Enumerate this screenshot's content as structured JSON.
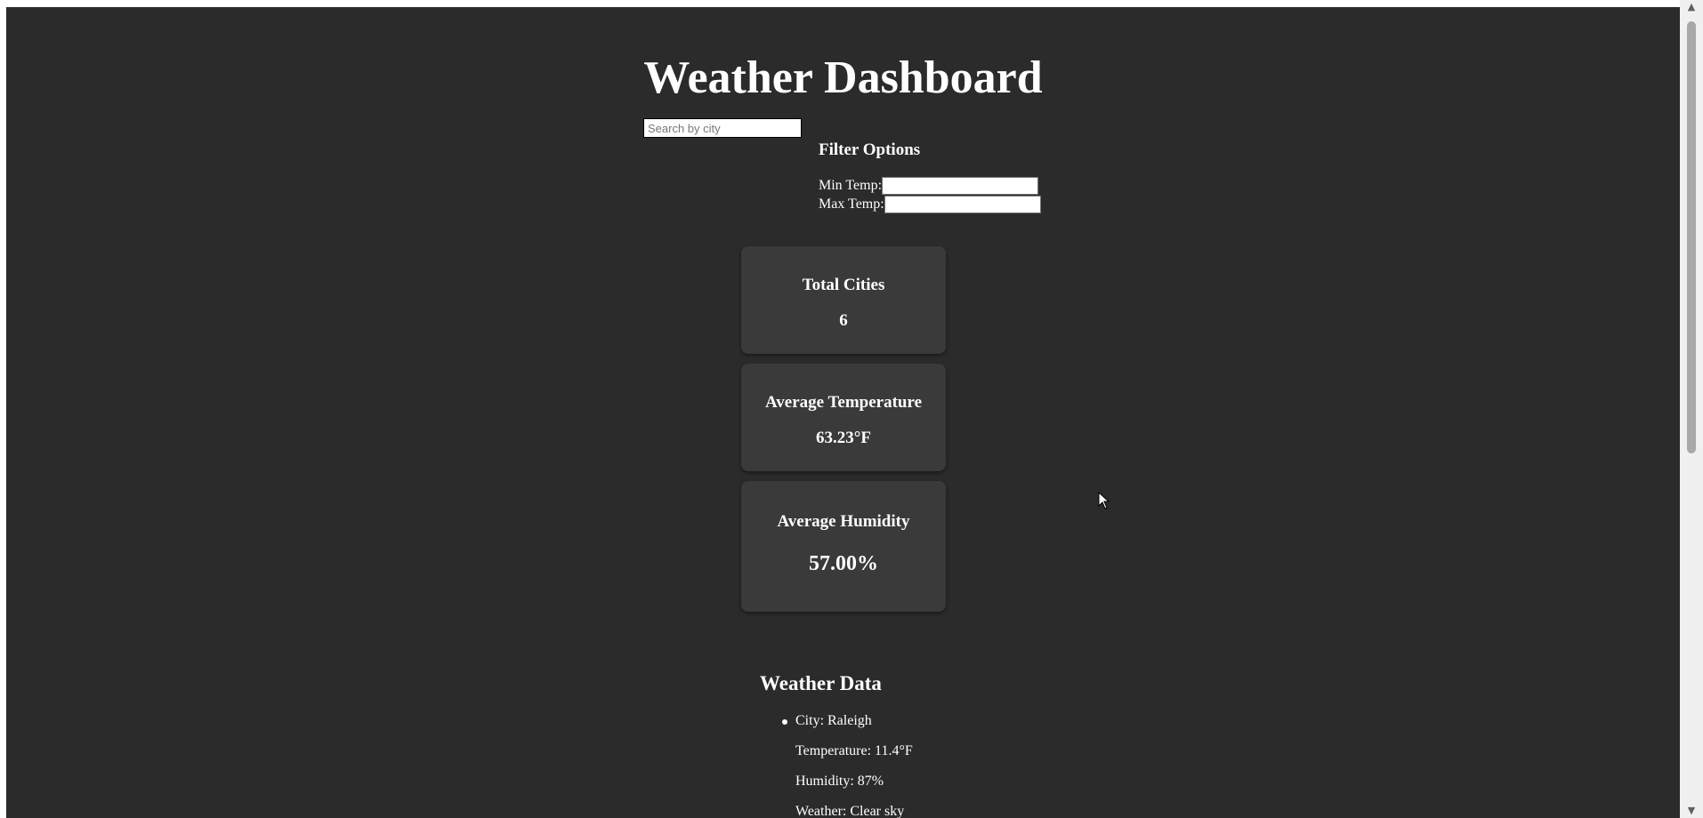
{
  "header": {
    "title": "Weather Dashboard"
  },
  "search": {
    "placeholder": "Search by city"
  },
  "filter": {
    "title": "Filter Options",
    "min_label": "Min Temp:",
    "max_label": "Max Temp:"
  },
  "stats": [
    {
      "label": "Total Cities",
      "value": "6"
    },
    {
      "label": "Average Temperature",
      "value": "63.23°F"
    },
    {
      "label": "Average Humidity",
      "value": "57.00%"
    }
  ],
  "weather": {
    "title": "Weather Data",
    "items": [
      {
        "city": "City: Raleigh",
        "temperature": "Temperature: 11.4°F",
        "humidity": "Humidity: 87%",
        "weather": "Weather: Clear sky"
      }
    ]
  },
  "colors": {
    "background": "#2b2b2b",
    "card": "#3a3a3a",
    "text": "#ffffff"
  },
  "icons": {
    "scroll_up": "▲",
    "scroll_down": "▼"
  }
}
